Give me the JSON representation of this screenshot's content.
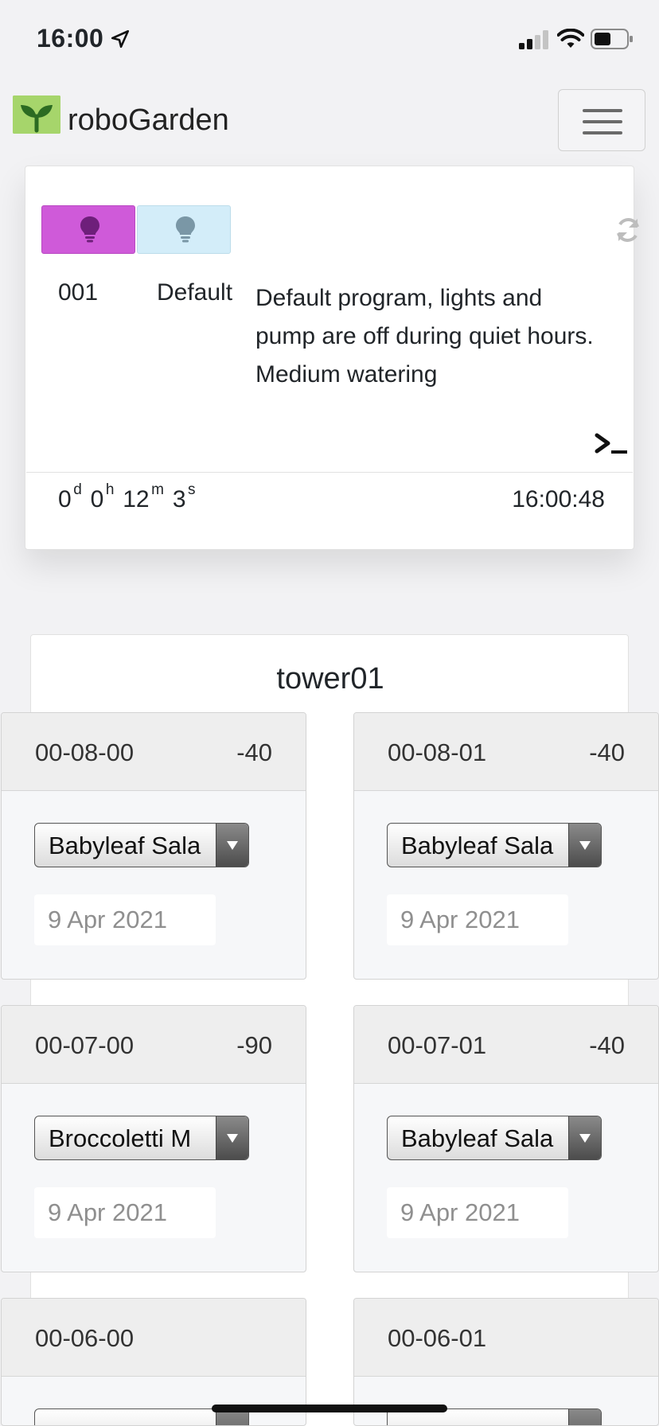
{
  "status_bar": {
    "time": "16:00",
    "icons": [
      "location-arrow-icon",
      "cellular-signal-icon",
      "wifi-icon",
      "battery-icon"
    ]
  },
  "navbar": {
    "brand": "roboGarden",
    "logo_icon": "sprout-icon",
    "menu_icon": "hamburger-menu-icon"
  },
  "program": {
    "light_buttons": [
      {
        "icon": "lightbulb-icon",
        "state": "on",
        "color": "#cf5ad9"
      },
      {
        "icon": "lightbulb-icon",
        "state": "off",
        "color": "#d3edf9"
      }
    ],
    "refresh_icon": "refresh-icon",
    "id": "001",
    "name": "Default",
    "description": "Default program, lights and pump are off during quiet hours. Medium watering",
    "console_icon": "terminal-icon",
    "uptime": {
      "days": "0",
      "days_unit": "d",
      "hours": "0",
      "hours_unit": "h",
      "minutes": "12",
      "minutes_unit": "m",
      "seconds": "3",
      "seconds_unit": "s"
    },
    "clock": "16:00:48"
  },
  "tower": {
    "title": "tower01",
    "slots": [
      {
        "id": "00-08-00",
        "signal": "-40",
        "plant": "Babyleaf Sala",
        "date": "9 Apr 2021"
      },
      {
        "id": "00-08-01",
        "signal": "-40",
        "plant": "Babyleaf Sala",
        "date": "9 Apr 2021"
      },
      {
        "id": "00-07-00",
        "signal": "-90",
        "plant": "Broccoletti M",
        "date": "9 Apr 2021"
      },
      {
        "id": "00-07-01",
        "signal": "-40",
        "plant": "Babyleaf Sala",
        "date": "9 Apr 2021"
      },
      {
        "id": "00-06-00",
        "signal": "",
        "plant": "",
        "date": ""
      },
      {
        "id": "00-06-01",
        "signal": "",
        "plant": "",
        "date": ""
      }
    ]
  }
}
